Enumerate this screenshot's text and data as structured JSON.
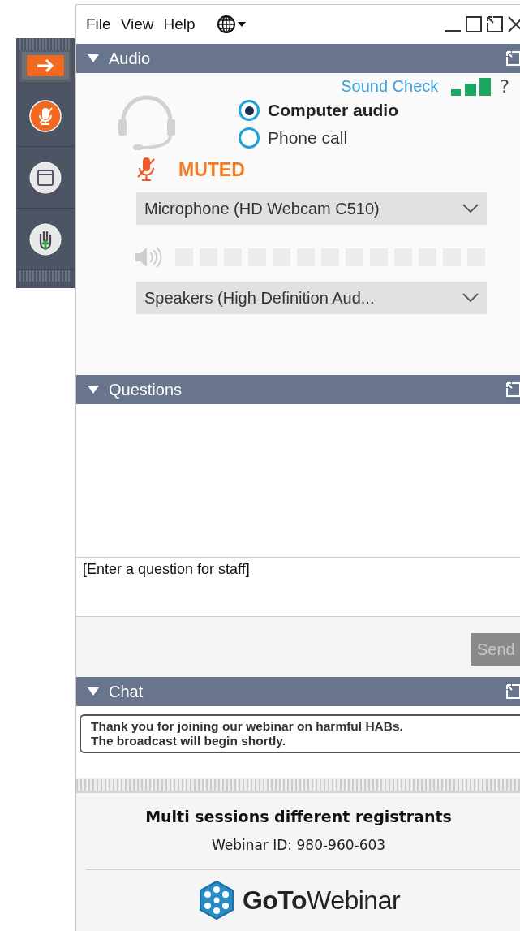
{
  "menu": [
    "File",
    "View",
    "Help"
  ],
  "audio": {
    "title": "Audio",
    "expanded": true,
    "sound_check": "Sound Check",
    "help": "?",
    "options": [
      {
        "label": "Computer audio",
        "selected": true
      },
      {
        "label": "Phone call",
        "selected": false
      }
    ],
    "status": {
      "label": "MUTED",
      "muted": true
    },
    "microphone": "Microphone (HD Webcam C510)",
    "speakers": "Speakers (High Definition Aud..."
  },
  "questions": {
    "title": "Questions",
    "expanded": true,
    "placeholder": "[Enter a question for staff]",
    "send": {
      "label": "Send",
      "disabled": true
    }
  },
  "chat": {
    "title": "Chat",
    "expanded": true,
    "message_lines": [
      "Thank you for joining our webinar on harmful HABs.",
      "The broadcast will begin shortly."
    ]
  },
  "footer": {
    "webinar_title": "Multi sessions different registrants",
    "webinar_id": "Webinar ID: 980-960-603",
    "brand": "**GoTo**Webinar"
  }
}
